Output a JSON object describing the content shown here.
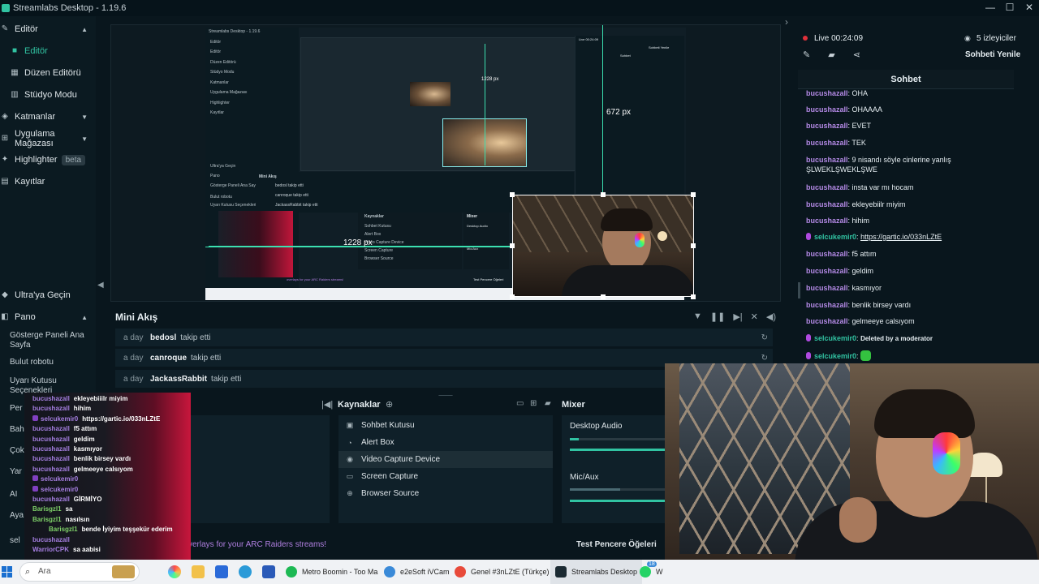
{
  "window": {
    "title": "Streamlabs Desktop - 1.19.6",
    "controls": [
      "—",
      "☐",
      "✕"
    ]
  },
  "sidebar": {
    "editor_section": "Editör",
    "items": [
      {
        "label": "Editör"
      },
      {
        "label": "Düzen Editörü"
      },
      {
        "label": "Stüdyo Modu"
      }
    ],
    "layers": "Katmanlar",
    "app_store": "Uygulama Mağazası",
    "highlighter": "Highlighter",
    "highlighter_badge": "beta",
    "records": "Kayıtlar",
    "ultra": "Ultra'ya Geçin",
    "pano": "Pano",
    "pano_items": [
      "Gösterge Paneli Ana Sayfa",
      "Bulut robotu",
      "Uyarı Kutusu Seçenekleri"
    ],
    "truncated": [
      "Per",
      "Bah",
      "Çok",
      "Yar",
      "AI",
      "Aya",
      "sel"
    ]
  },
  "editor": {
    "measure_width": "1228 px",
    "measure_height": "672 px",
    "nested": {
      "title": "Streamlabs Desktop - 1.19.6",
      "side": [
        "Editör",
        "Editör",
        "Düzen Editörü",
        "Stüdyo Modu",
        "Katmanlar",
        "Uygulama Mağazası",
        "Highlighter",
        "Kayıtlar",
        "Ultra'ya Geçin",
        "Pano",
        "Gösterge Paneli Ana Sayfa",
        "Bulut robotu",
        "Uyarı Kutusu Seçenekleri"
      ],
      "mini_title": "Mini Akış",
      "mini_rows": [
        "bedosl takip etti",
        "canroque takip etti",
        "JackassRabbit takip etti"
      ],
      "sources_title": "Kaynaklar",
      "sources": [
        "Sohbet Kutusu",
        "Alert Box",
        "Video Capture Device",
        "Screen Capture",
        "Browser Source"
      ],
      "mixer_title": "Mixer",
      "mixer": [
        "Desktop Audio",
        "Mic/Aux"
      ],
      "chat_title": "Sohbet",
      "live": "Live 00:24:09",
      "refresh": "Sohbeti Yenile",
      "test": "Test Pencere Öğeleri",
      "overlay_link": "overlays for your ARC Raiders streams!"
    }
  },
  "mini_feed": {
    "title": "Mini Akış",
    "tools": [
      "filter-icon",
      "pause-icon",
      "skip-icon",
      "mute-icon",
      "volume-icon"
    ],
    "rows": [
      {
        "ago": "a day",
        "user": "bedosl",
        "action": "takip etti"
      },
      {
        "ago": "a day",
        "user": "canroque",
        "action": "takip etti"
      },
      {
        "ago": "a day",
        "user": "JackassRabbit",
        "action": "takip etti"
      }
    ]
  },
  "sources": {
    "title": "Kaynaklar",
    "items": [
      {
        "label": "Sohbet Kutusu",
        "icon": "chat-icon"
      },
      {
        "label": "Alert Box",
        "icon": "bell-icon"
      },
      {
        "label": "Video Capture Device",
        "icon": "webcam-icon",
        "selected": true
      },
      {
        "label": "Screen Capture",
        "icon": "monitor-icon"
      },
      {
        "label": "Browser Source",
        "icon": "globe-icon"
      }
    ]
  },
  "mixer": {
    "title": "Mixer",
    "channels": [
      {
        "name": "Desktop Audio",
        "level": 0.09
      },
      {
        "name": "Mic/Aux",
        "level": 0.52
      }
    ]
  },
  "bottom_footer": {
    "overlay_link": "verlays for your ARC Raiders streams!",
    "test_widgets": "Test Pencere Öğeleri"
  },
  "chat_overlay": {
    "lines": [
      {
        "user": "bucushazall",
        "text": "ekleyebiiilr miyim"
      },
      {
        "user": "bucushazall",
        "text": "hihim"
      },
      {
        "user": "selcukemir0",
        "text": "https://gartic.io/033nLZtE",
        "badge": true
      },
      {
        "user": "bucushazall",
        "text": "f5 attım"
      },
      {
        "user": "bucushazall",
        "text": "geldim"
      },
      {
        "user": "bucushazall",
        "text": "kasmıyor"
      },
      {
        "user": "bucushazall",
        "text": "benlik birsey vardı"
      },
      {
        "user": "bucushazall",
        "text": "gelmeeye calsıyom"
      },
      {
        "user": "selcukemir0",
        "text": "",
        "badge": true
      },
      {
        "user": "selcukemir0",
        "text": "",
        "badge": true
      },
      {
        "user": "bucushazall",
        "text": "GİRMİYO"
      },
      {
        "user": "Barisgzl1",
        "text": "sa",
        "green": true
      },
      {
        "user": "Barisgzl1",
        "text": "nasılsın",
        "green": true
      },
      {
        "user": "Barisgzl1",
        "text": "bende İyiyim teşşekür ederim",
        "green": true
      },
      {
        "user": "bucushazall",
        "text": ""
      },
      {
        "user": "WarriorCPK",
        "text": "sa aabisi"
      }
    ]
  },
  "right_panel": {
    "live": "Live 00:24:09",
    "viewers": "5 izleyiciler",
    "refresh": "Sohbeti Yenile",
    "chat_title": "Sohbet",
    "messages": [
      {
        "user": "bucushazall",
        "text": "OHA"
      },
      {
        "user": "bucushazall",
        "text": "OHAAAA"
      },
      {
        "user": "bucushazall",
        "text": "EVET"
      },
      {
        "user": "bucushazall",
        "text": "TEK"
      },
      {
        "user": "bucushazall",
        "text": "9 nisandı söyle cinlerine yanlış",
        "text2": "ŞLWEKLŞWEKLŞWE"
      },
      {
        "user": "bucushazall",
        "text": "insta var mı hocam"
      },
      {
        "user": "bucushazall",
        "text": "ekleyebiilr miyim"
      },
      {
        "user": "bucushazall",
        "text": "hihim"
      },
      {
        "user": "selcukemir0",
        "text": "https://gartic.io/033nLZtE",
        "badge": true,
        "link": true
      },
      {
        "user": "bucushazall",
        "text": "f5 attım"
      },
      {
        "user": "bucushazall",
        "text": "geldim"
      },
      {
        "user": "bucushazall",
        "text": "kasmıyor"
      },
      {
        "user": "bucushazall",
        "text": "benlik birsey vardı"
      },
      {
        "user": "bucushazall",
        "text": "gelmeeye calsıyom"
      },
      {
        "user": "selcukemir0",
        "text": "Deleted by a moderator",
        "badge": true,
        "mod": true
      },
      {
        "user": "selcukemir0",
        "text": "",
        "badge": true,
        "emote": true
      }
    ]
  },
  "taskbar": {
    "search": "Ara",
    "apps": [
      {
        "label": "Metro Boomin - Too Ma",
        "color": "#1db954"
      },
      {
        "label": "e2eSoft iVCam",
        "color": "#3a8ad8"
      },
      {
        "label": "Genel #3nLZtE (Türkçe)",
        "color": "#e84a3a"
      },
      {
        "label": "Streamlabs Desktop",
        "color": "#1b2a32",
        "active": true
      },
      {
        "label": "W",
        "color": "#25d366"
      }
    ],
    "whatsapp_badge": "18"
  },
  "colors": {
    "accent": "#31c3a2",
    "bg": "#09161d",
    "panel": "#0f2029",
    "chat_user": "#b48ae6",
    "live_red": "#e0303a"
  }
}
